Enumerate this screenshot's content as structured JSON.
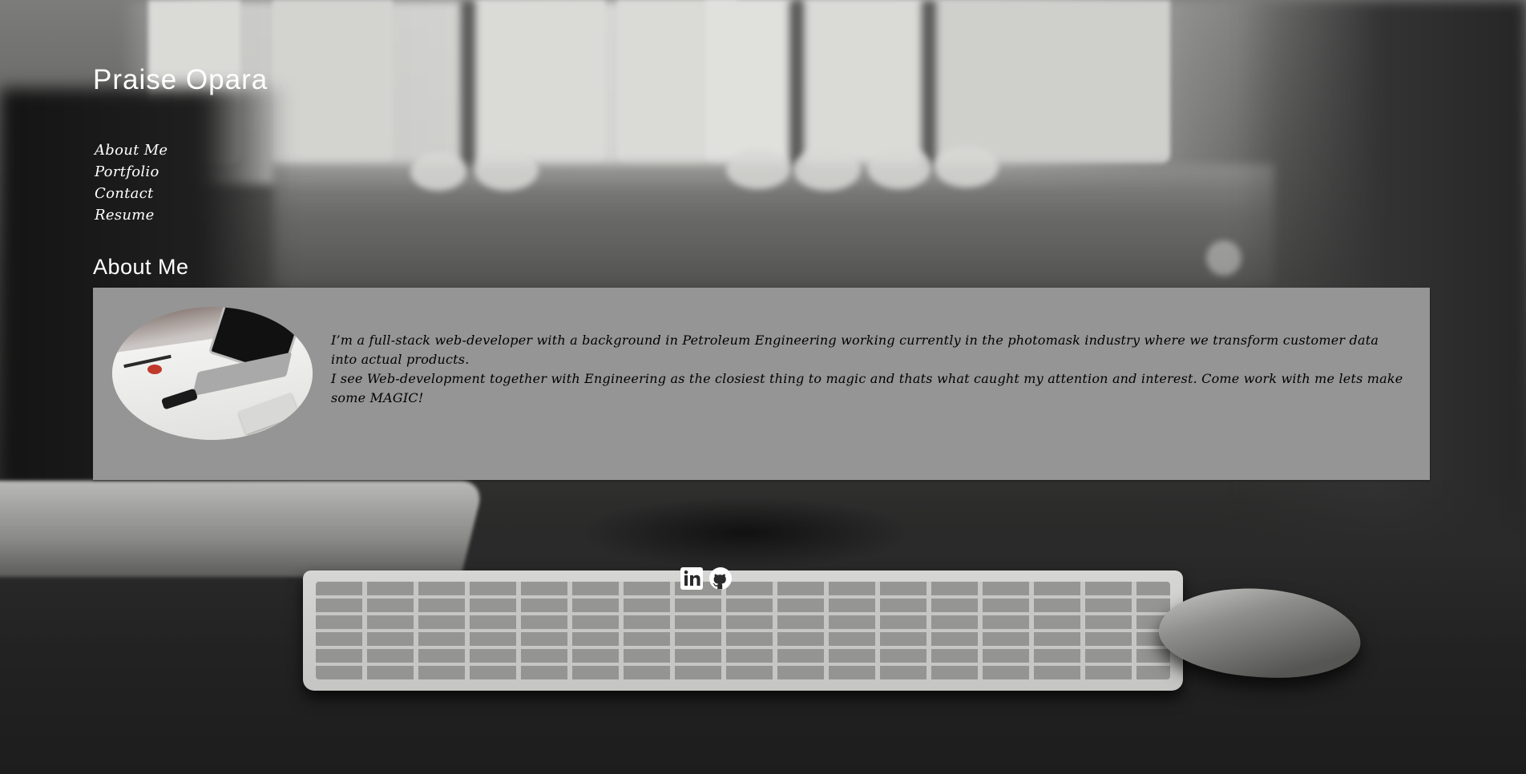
{
  "site": {
    "title": "Praise Opara"
  },
  "nav": {
    "items": [
      {
        "label": "About Me"
      },
      {
        "label": "Portfolio"
      },
      {
        "label": "Contact"
      },
      {
        "label": "Resume"
      }
    ]
  },
  "about": {
    "heading": "About Me",
    "image_alt": "Laptop on a white desk",
    "paragraphs": [
      "I’m a full-stack web-developer with a background in Petroleum Engineering working currently in the photomask industry where we transform customer data into actual products.",
      "I see Web-development together with Engineering as the closiest thing to magic and thats what caught my attention and interest. Come work with me lets make some MAGIC!"
    ]
  },
  "footer": {
    "social": [
      {
        "icon": "linkedin-icon"
      },
      {
        "icon": "github-icon"
      }
    ]
  },
  "colors": {
    "text_light": "#ffffff",
    "card_background": "#959595",
    "card_text": "#000000"
  }
}
